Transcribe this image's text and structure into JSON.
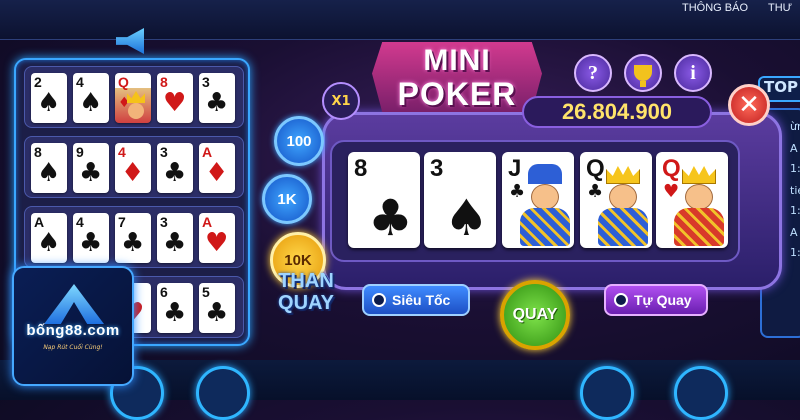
{
  "top_nav": {
    "notifications": "THÔNG BÁO",
    "other": "THƯ"
  },
  "title": {
    "line1": "MINI",
    "line2": "POKER"
  },
  "multiplier": "X1",
  "jackpot": "26.804.900",
  "icons": {
    "help": "?",
    "trophy": "trophy-icon",
    "info": "i",
    "close": "✕"
  },
  "bets": [
    "100",
    "1K",
    "10K"
  ],
  "auto_label": {
    "line1": "THAN",
    "line2": "QUAY"
  },
  "hand": [
    {
      "rank": "8",
      "suit": "♣",
      "color": "black",
      "face": false
    },
    {
      "rank": "3",
      "suit": "♠",
      "color": "black",
      "face": false
    },
    {
      "rank": "J",
      "suit": "♣",
      "color": "black",
      "face": true
    },
    {
      "rank": "Q",
      "suit": "♣",
      "color": "black",
      "face": true
    },
    {
      "rank": "Q",
      "suit": "♥",
      "color": "red",
      "face": true
    }
  ],
  "history": [
    [
      {
        "rank": "2",
        "suit": "♠",
        "color": "black"
      },
      {
        "rank": "4",
        "suit": "♠",
        "color": "black"
      },
      {
        "rank": "Q",
        "suit": "♦",
        "color": "red",
        "face": true
      },
      {
        "rank": "8",
        "suit": "♥",
        "color": "red"
      },
      {
        "rank": "3",
        "suit": "♣",
        "color": "black"
      }
    ],
    [
      {
        "rank": "8",
        "suit": "♠",
        "color": "black"
      },
      {
        "rank": "9",
        "suit": "♣",
        "color": "black"
      },
      {
        "rank": "4",
        "suit": "♦",
        "color": "red"
      },
      {
        "rank": "3",
        "suit": "♣",
        "color": "black"
      },
      {
        "rank": "A",
        "suit": "♦",
        "color": "red"
      }
    ],
    [
      {
        "rank": "A",
        "suit": "♠",
        "color": "black"
      },
      {
        "rank": "4",
        "suit": "♣",
        "color": "black"
      },
      {
        "rank": "7",
        "suit": "♣",
        "color": "black"
      },
      {
        "rank": "3",
        "suit": "♣",
        "color": "black"
      },
      {
        "rank": "A",
        "suit": "♥",
        "color": "red"
      }
    ],
    [
      {
        "rank": "",
        "suit": "",
        "color": "black"
      },
      {
        "rank": "",
        "suit": "",
        "color": "black"
      },
      {
        "rank": "6",
        "suit": "♥",
        "color": "red"
      },
      {
        "rank": "6",
        "suit": "♣",
        "color": "black"
      },
      {
        "rank": "5",
        "suit": "♣",
        "color": "black"
      }
    ]
  ],
  "controls": {
    "fast": "Siêu Tốc",
    "spin": "QUAY",
    "auto": "Tự Quay"
  },
  "logo": {
    "text": "bống88.com",
    "tagline": "Nạp Rút Cuối Cùng!"
  },
  "right_panel": {
    "tab": "TOP",
    "lines": [
      "ừng",
      "A",
      "1:",
      "tie",
      "1:",
      "A",
      "1:"
    ]
  },
  "colors": {
    "accent": "#3aa7ff",
    "jackpot": "#ffe36a",
    "spin": "#4cbf20",
    "panel": "#5b3c9f"
  }
}
